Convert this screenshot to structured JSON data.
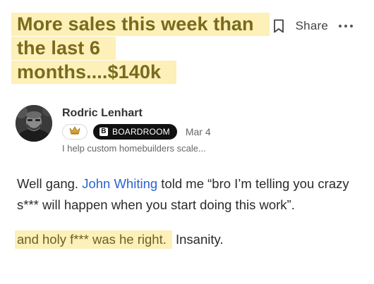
{
  "post": {
    "title": "More sales this week than the last 6 months....$140k",
    "title_color": "#7a6a1e",
    "highlight_color": "#fdf0b8"
  },
  "actions": {
    "bookmark_icon": "bookmark-icon",
    "share_label": "Share",
    "more_icon": "more-horizontal-icon"
  },
  "author": {
    "name": "Rodric Lenhart",
    "crown_badge_icon": "crown-icon",
    "tier_badge": "BOARDROOM",
    "tier_logo": "B",
    "date": "Mar 4",
    "bio": "I help custom homebuilders scale..."
  },
  "body": {
    "p1_before": "Well gang. ",
    "mention": "John Whiting",
    "p1_after": " told me “bro I’m telling you crazy s*** will happen when you start doing this work”.",
    "p2_highlight": "and holy f*** was he right.",
    "p2_rest": " Insanity.",
    "mention_color": "#2a63d4"
  }
}
